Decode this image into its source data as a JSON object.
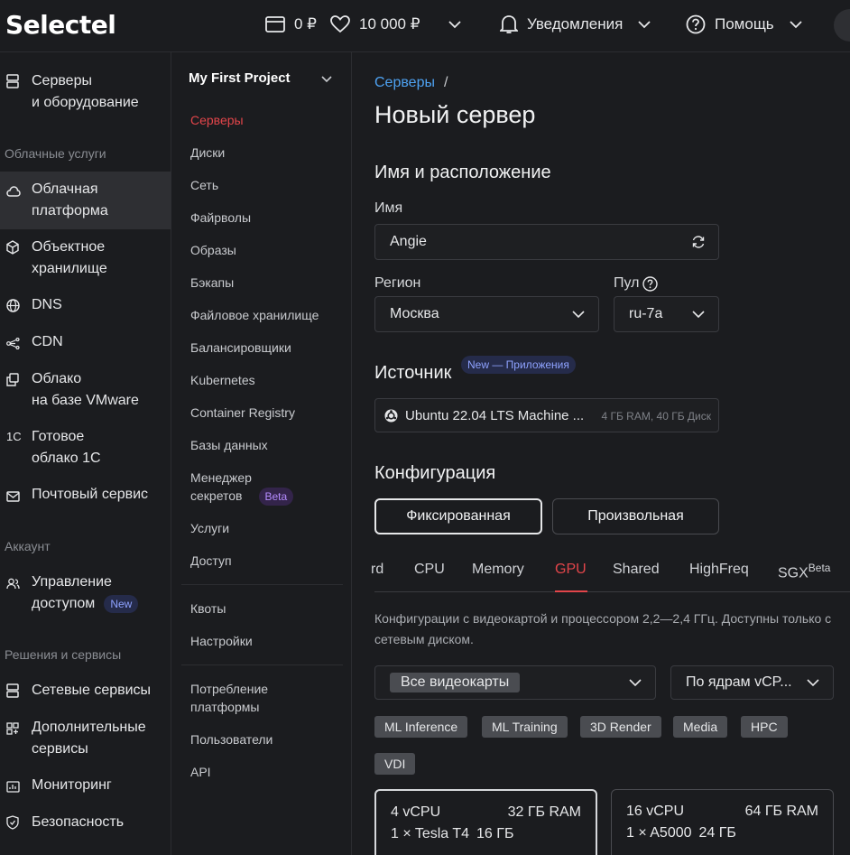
{
  "topbar": {
    "logo": "Selectel",
    "balance": "0 ₽",
    "bonus": "10 000 ₽",
    "notifications": "Уведомления",
    "help": "Помощь"
  },
  "left_nav": {
    "item_servers": [
      "Серверы",
      "и оборудование"
    ],
    "section_cloud": "Облачные услуги",
    "item_cloud_platform": [
      "Облачная",
      "платформа"
    ],
    "item_object_storage": [
      "Объектное",
      "хранилище"
    ],
    "item_dns": "DNS",
    "item_cdn": "CDN",
    "item_vmware": [
      "Облако",
      "на базе VMware"
    ],
    "item_1c": [
      "Готовое",
      "облако 1С"
    ],
    "item_mail": "Почтовый сервис",
    "section_account": "Аккаунт",
    "item_access": [
      "Управление",
      "доступом"
    ],
    "access_badge": "New",
    "section_solutions": "Решения и сервисы",
    "item_network": "Сетевые сервисы",
    "item_additional": [
      "Дополнительные",
      "сервисы"
    ],
    "item_monitoring": "Мониторинг",
    "item_security": "Безопасность",
    "icon_1c_text": "1C"
  },
  "project_nav": {
    "title": "My First Project",
    "items": [
      "Серверы",
      "Диски",
      "Сеть",
      "Файрволы",
      "Образы",
      "Бэкапы",
      "Файловое хранилище",
      "Балансировщики",
      "Kubernetes",
      "Container Registry",
      "Базы данных"
    ],
    "secrets": [
      "Менеджер",
      "секретов"
    ],
    "secrets_badge": "Beta",
    "items2": [
      "Услуги",
      "Доступ"
    ],
    "items3": [
      "Квоты",
      "Настройки"
    ],
    "consumption": [
      "Потребление",
      "платформы"
    ],
    "items4": [
      "Пользователи",
      "API"
    ]
  },
  "main": {
    "breadcrumb": "Серверы",
    "breadcrumb_sep": "/",
    "title": "Новый сервер",
    "section_name": "Имя и расположение",
    "name_label": "Имя",
    "name_value": "Angie",
    "region_label": "Регион",
    "region_value": "Москва",
    "pool_label": "Пул",
    "pool_value": "ru-7a",
    "section_source": "Источник",
    "source_badge": "New — Приложения",
    "source_value": "Ubuntu 22.04 LTS Machine ...",
    "source_meta": "4 ГБ RAM, 40 ГБ Диск",
    "section_config": "Конфигурация",
    "config_fixed": "Фиксированная",
    "config_custom": "Произвольная",
    "tabs": [
      "rd",
      "CPU",
      "Memory",
      "GPU",
      "Shared",
      "HighFreq",
      "SGX"
    ],
    "tab_sgx_sup": "Beta",
    "description": "Конфигурации с видеокартой и процессором 2,2—2,4 ГГц. Доступны только с сетевым диском.",
    "gpu_filter": "Все видеокарты",
    "sort_value": "По ядрам vCP...",
    "chips": [
      "ML Inference",
      "ML Training",
      "3D Render",
      "Media",
      "HPC",
      "VDI"
    ],
    "cards": [
      {
        "cpu": "4 vCPU",
        "ram": "32 ГБ RAM",
        "gpu": "1 × Tesla T4",
        "vram": "16 ГБ"
      },
      {
        "cpu": "16 vCPU",
        "ram": "64 ГБ RAM",
        "gpu": "1 × A5000",
        "vram": "24 ГБ"
      }
    ]
  },
  "colors": {
    "accent": "#e2454a",
    "link": "#4ea2f2",
    "background": "#1b1c1f"
  }
}
